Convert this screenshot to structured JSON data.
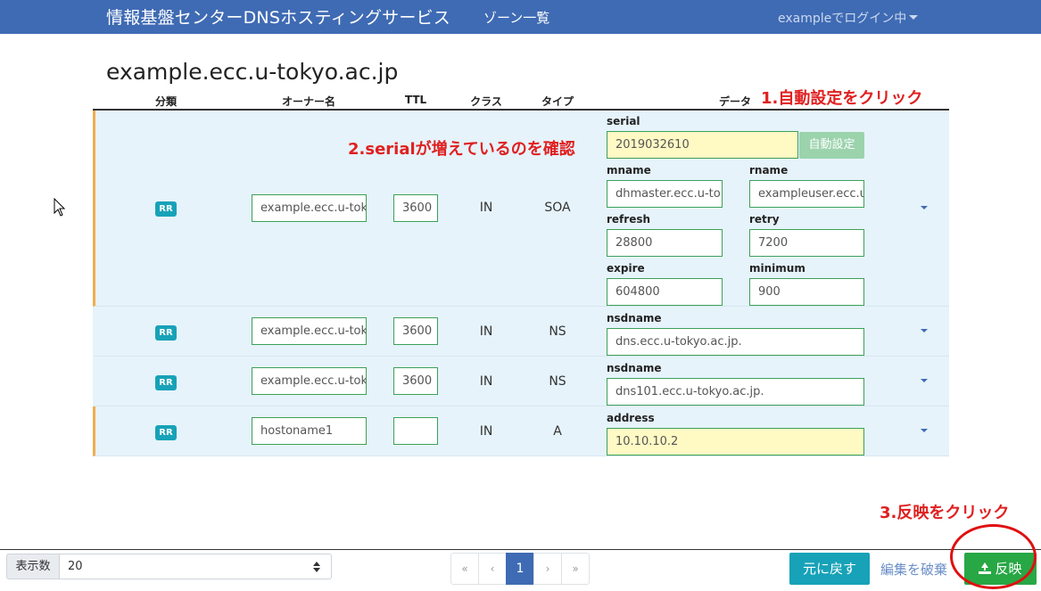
{
  "navbar": {
    "brand": "情報基盤センターDNSホスティングサービス",
    "zones_link": "ゾーン一覧",
    "user_menu": "exampleでログイン中"
  },
  "zone_title": "example.ecc.u-tokyo.ac.jp",
  "table": {
    "headers": {
      "category": "分類",
      "owner": "オーナー名",
      "ttl": "TTL",
      "class": "クラス",
      "type": "タイプ",
      "data": "データ"
    },
    "rows": [
      {
        "badge": "RR",
        "owner": "example.ecc.u-tok",
        "ttl": "3600",
        "class": "IN",
        "type": "SOA",
        "fields": {
          "serial_label": "serial",
          "serial": "2019032610",
          "mname_label": "mname",
          "mname": "dhmaster.ecc.u-to",
          "rname_label": "rname",
          "rname": "exampleuser.ecc.u",
          "refresh_label": "refresh",
          "refresh": "28800",
          "retry_label": "retry",
          "retry": "7200",
          "expire_label": "expire",
          "expire": "604800",
          "minimum_label": "minimum",
          "minimum": "900"
        },
        "auto_button": "自動設定"
      },
      {
        "badge": "RR",
        "owner": "example.ecc.u-tok",
        "ttl": "3600",
        "class": "IN",
        "type": "NS",
        "data_label": "nsdname",
        "data_value": "dns.ecc.u-tokyo.ac.jp."
      },
      {
        "badge": "RR",
        "owner": "example.ecc.u-tok",
        "ttl": "3600",
        "class": "IN",
        "type": "NS",
        "data_label": "nsdname",
        "data_value": "dns101.ecc.u-tokyo.ac.jp."
      },
      {
        "badge": "RR",
        "owner": "hostoname1",
        "ttl": "",
        "class": "IN",
        "type": "A",
        "data_label": "address",
        "data_value": "10.10.10.2"
      }
    ]
  },
  "annotations": {
    "step1": "1.自動設定をクリック",
    "step2": "2.serialが増えているのを確認",
    "step3": "3.反映をクリック"
  },
  "footer": {
    "per_page_label": "表示数",
    "per_page_value": "20",
    "pagination": [
      "«",
      "‹",
      "1",
      "›",
      "»"
    ],
    "revert_button": "元に戻す",
    "discard_link": "編集を破棄",
    "apply_button": "反映"
  },
  "colors": {
    "navbar": "#3f6bb4",
    "row_bg": "#e6f3fb",
    "modified_marker": "#f0ad4e",
    "annotation": "#e02020",
    "apply": "#28a745",
    "revert": "#17a2b8"
  },
  "icons": [
    "caret-down-icon",
    "upload-icon",
    "mouse-cursor-icon"
  ]
}
